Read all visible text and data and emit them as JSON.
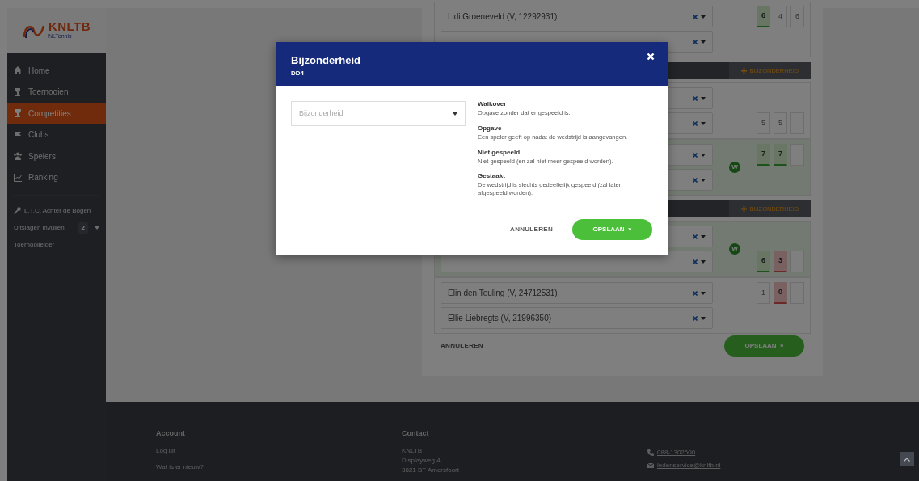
{
  "logo": {
    "name": "KNLTB",
    "tagline": "NLTennis"
  },
  "sidebar": {
    "items": [
      {
        "label": "Home",
        "kind": "home",
        "selected": false
      },
      {
        "label": "Toernooien",
        "kind": "tournament",
        "selected": false
      },
      {
        "label": "Competities",
        "kind": "trophy",
        "selected": true
      },
      {
        "label": "Clubs",
        "kind": "flag",
        "selected": false
      },
      {
        "label": "Spelers",
        "kind": "players",
        "selected": false
      },
      {
        "label": "Ranking",
        "kind": "chart",
        "selected": false
      }
    ],
    "club": "L.T.C. Achter de Bogen",
    "links": [
      {
        "label": "Uitslagen invullen",
        "badge": "2",
        "dropdown": true
      },
      {
        "label": "Toernooileider",
        "dropdown": false
      }
    ]
  },
  "sections": [
    {
      "teams": [
        {
          "winner": false,
          "players": [
            {
              "name": "Lidi Groeneveld (V, 12292931)",
              "clearable": true,
              "scores": [
                {
                  "value": "6",
                  "won": true,
                  "lost": false
                },
                {
                  "value": "4",
                  "won": false,
                  "lost": false
                },
                {
                  "value": "6",
                  "won": false,
                  "lost": false
                }
              ]
            },
            {
              "clearable": true
            }
          ]
        }
      ]
    },
    {
      "header": {
        "button": "BIJZONDERHEID"
      },
      "teams": [
        {
          "winner": false,
          "players": [
            {
              "clearable": true
            },
            {
              "clearable": true,
              "scores": [
                {
                  "value": "5",
                  "won": false,
                  "lost": false
                },
                {
                  "value": "5",
                  "won": false,
                  "lost": false
                },
                {
                  "won": false,
                  "lost": false
                }
              ]
            }
          ]
        },
        {
          "winner": true,
          "badge": "W",
          "players": [
            {
              "clearable": true,
              "scores": [
                {
                  "value": "7",
                  "won": true,
                  "lost": false
                },
                {
                  "value": "7",
                  "won": true,
                  "lost": false
                },
                {
                  "won": false,
                  "lost": false
                }
              ]
            },
            {
              "clearable": true
            }
          ]
        }
      ]
    },
    {
      "header": {
        "button": "BIJZONDERHEID"
      },
      "teams": [
        {
          "winner": true,
          "badge": "W",
          "players": [
            {
              "clearable": true
            },
            {
              "clearable": true,
              "scores": [
                {
                  "value": "6",
                  "won": true,
                  "lost": false
                },
                {
                  "value": "3",
                  "won": false,
                  "lost": true
                },
                {
                  "won": false,
                  "lost": false
                }
              ]
            }
          ]
        },
        {
          "winner": false,
          "players": [
            {
              "name": "Elin den Teuling (V, 24712531)",
              "clearable": true,
              "scores": [
                {
                  "value": "1",
                  "won": false,
                  "lost": false
                },
                {
                  "value": "0",
                  "won": false,
                  "lost": true
                },
                {
                  "won": false,
                  "lost": false
                }
              ]
            },
            {
              "name": "Ellie Liebregts (V, 21996350)",
              "clearable": true
            }
          ]
        }
      ]
    }
  ],
  "form_actions": {
    "cancel": "ANNULEREN",
    "save": "OPSLAAN",
    "save_icon": "»"
  },
  "footer": {
    "account": {
      "heading": "Account",
      "links": [
        "Log uit",
        "Wat is er nieuw?"
      ]
    },
    "contact": {
      "heading": "Contact",
      "address": [
        "KNLTB",
        "Displayweg 4",
        "3821 BT Amersfoort"
      ],
      "phone": "088-1302600",
      "email": "ledenservice@knltb.nl"
    }
  },
  "modal": {
    "title": "Bijzonderheid",
    "subtitle": "DD4",
    "select": {
      "placeholder": "Bijzonderheid"
    },
    "definitions": [
      {
        "term": "Walkover",
        "description": "Opgave zonder dat er gespeeld is."
      },
      {
        "term": "Opgave",
        "description": "Een speler geeft op nadat de wedstrijd is aangevangen."
      },
      {
        "term": "Niet gespeeld",
        "description": "Niet gespeeld (en zal niet meer gespeeld worden)."
      },
      {
        "term": "Gestaakt",
        "description": "De wedstrijd is slechts gedeeltelijk gespeeld (zal later afgespeeld worden)."
      }
    ],
    "cancel": "ANNULEREN",
    "save": "OPSLAAN",
    "save_icon": "»"
  }
}
